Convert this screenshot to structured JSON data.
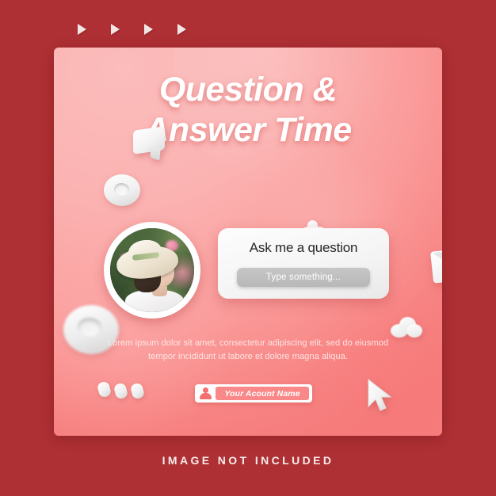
{
  "canvas": {
    "background_color": "#ae3034",
    "panel_gradient_from": "#fbbcbb",
    "panel_gradient_to": "#f57b7b"
  },
  "top_markers": {
    "icon": "play-triangle-icon",
    "count": 4
  },
  "post": {
    "title": "Question &\nAnswer Time",
    "avatar": {
      "icon": "profile-photo",
      "alt": "woman wearing white sun hat in garden"
    },
    "question_card": {
      "heading": "Ask me a question",
      "input_placeholder": "Type something...",
      "input_value": ""
    },
    "body_text": "Lorem ipsum dolor sit amet, consectetur adipiscing elit, sed do eiusmod tempor incididunt ut labore et dolore magna aliqua.",
    "account": {
      "icon": "user-avatar-icon",
      "name": "Your Acount Name"
    }
  },
  "decorations": [
    {
      "icon": "speech-bubble-3d-icon",
      "position": "top-left"
    },
    {
      "icon": "torus-ring-3d-icon",
      "position": "upper-left"
    },
    {
      "icon": "thumbs-up-3d-icon",
      "position": "center-top"
    },
    {
      "icon": "hashtag-3d-icon",
      "position": "top-right"
    },
    {
      "icon": "envelope-3d-icon",
      "position": "right"
    },
    {
      "icon": "torus-ring-3d-icon",
      "position": "lower-left"
    },
    {
      "icon": "cloud-3d-icon",
      "position": "lower-right"
    },
    {
      "icon": "capsule-3d-icon",
      "position": "bottom-left"
    },
    {
      "icon": "mouse-cursor-3d-icon",
      "position": "bottom-right"
    }
  ],
  "caption": "IMAGE NOT INCLUDED"
}
